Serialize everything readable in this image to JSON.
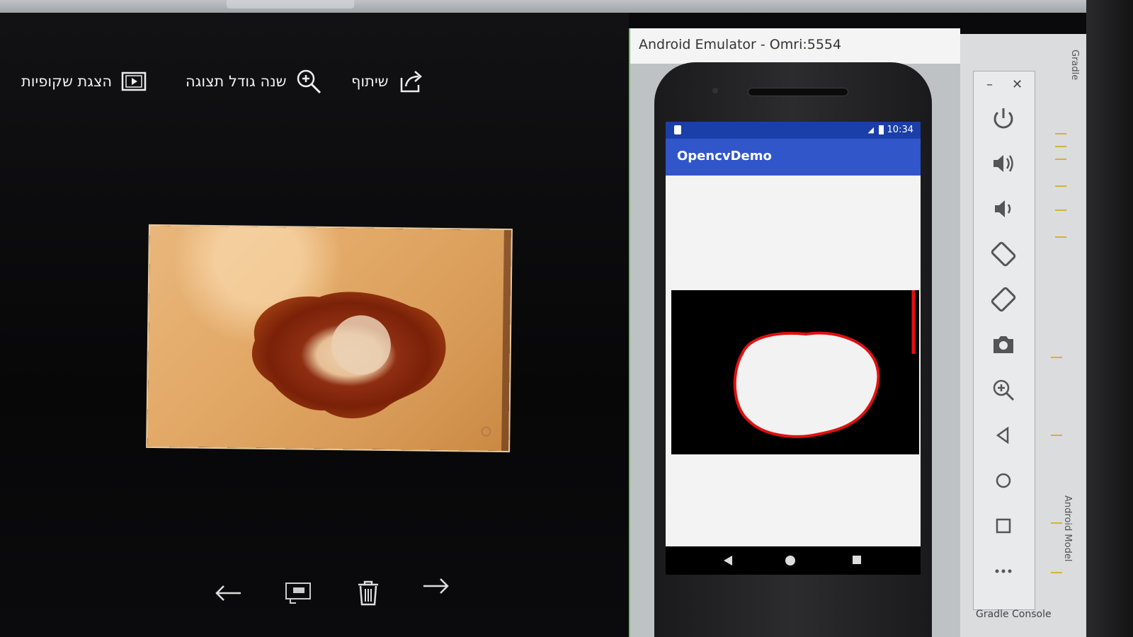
{
  "viewer": {
    "toolbar": {
      "slideshow_label": "הצגת שקופיות",
      "zoom_label": "שנה גודל תצוגה",
      "share_label": "שיתוף"
    },
    "photo_icon": "skin-lesion-photo",
    "bottom_icons": [
      "arrow-left-icon",
      "slideshow-icon",
      "trash-icon",
      "arrow-right-icon"
    ]
  },
  "emulator": {
    "window_title": "Android Emulator - Omri:5554",
    "status_time": "10:34",
    "app_title": "OpencvDemo",
    "result_image": "lesion-mask-with-red-contour",
    "side_panel_icons": [
      "power-icon",
      "volume-up-icon",
      "volume-down-icon",
      "rotate-left-icon",
      "rotate-right-icon",
      "camera-icon",
      "zoom-icon",
      "back-icon",
      "home-icon",
      "overview-icon",
      "more-icon"
    ]
  },
  "ide": {
    "gradle_tab": "Gradle",
    "android_model_tab": "Android Model",
    "gradle_console": "Gradle Console"
  },
  "colors": {
    "app_bar": "#3156c9",
    "status_bar": "#1b3fa8",
    "contour": "#e01010",
    "window_border": "#6cc26a"
  }
}
